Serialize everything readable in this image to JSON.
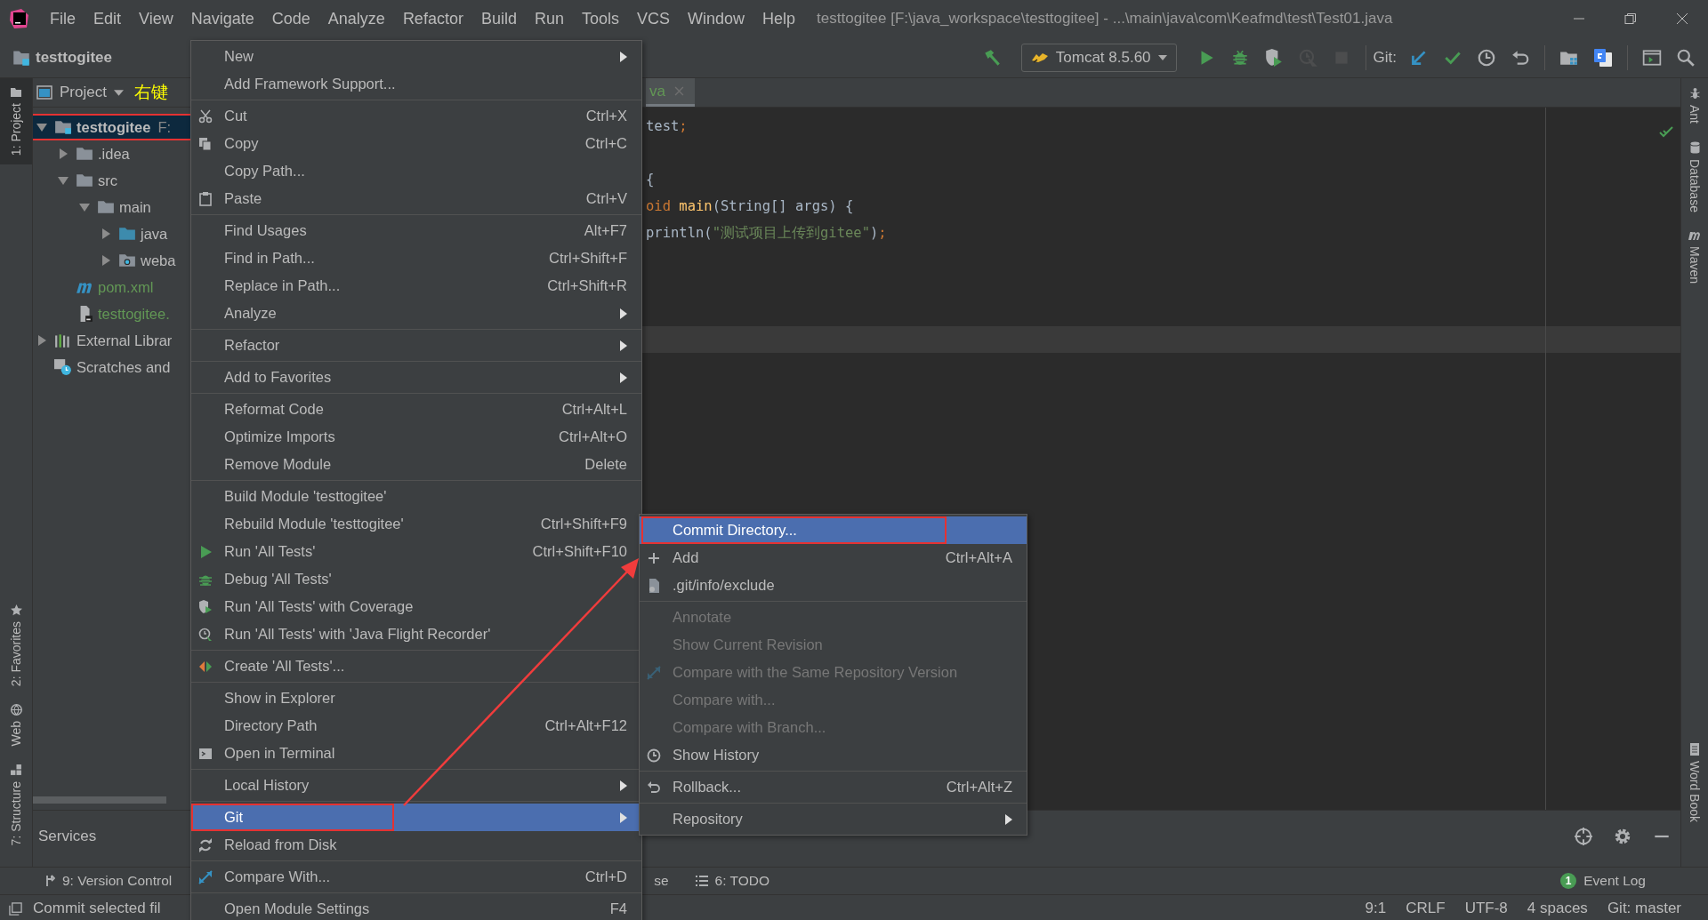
{
  "title_bar": {
    "menus": [
      "File",
      "Edit",
      "View",
      "Navigate",
      "Code",
      "Analyze",
      "Refactor",
      "Build",
      "Run",
      "Tools",
      "VCS",
      "Window",
      "Help"
    ],
    "title": "testtogitee [F:\\java_workspace\\testtogitee] - ...\\main\\java\\com\\Keafmd\\test\\Test01.java"
  },
  "nav_bar": {
    "breadcrumb": "testtogitee",
    "run_config": "Tomcat 8.5.60",
    "git_label": "Git:",
    "run_buttons": [
      {
        "kind": "build",
        "disabled": false
      },
      {
        "kind": "run",
        "disabled": false
      },
      {
        "kind": "debug",
        "disabled": false
      },
      {
        "kind": "coverage",
        "disabled": false
      },
      {
        "kind": "profile",
        "disabled": true
      },
      {
        "kind": "stop",
        "disabled": true
      }
    ],
    "vcs_buttons": [
      {
        "kind": "update",
        "disabled": false
      },
      {
        "kind": "commit",
        "disabled": false
      },
      {
        "kind": "history",
        "disabled": false
      },
      {
        "kind": "revert",
        "disabled": false
      }
    ],
    "tool_buttons": [
      {
        "kind": "structure",
        "disabled": false
      },
      {
        "kind": "translate",
        "disabled": false
      },
      {
        "kind": "terminal",
        "disabled": false
      },
      {
        "kind": "search",
        "disabled": false
      }
    ]
  },
  "left_strip": {
    "top": [
      {
        "label": "1: Project",
        "kind": "project",
        "selected": true
      }
    ],
    "bottom": [
      {
        "label": "2: Favorites",
        "kind": "favorites",
        "selected": false
      },
      {
        "label": "Web",
        "kind": "web",
        "selected": false
      },
      {
        "label": "7: Structure",
        "kind": "structure",
        "selected": false
      }
    ]
  },
  "project_panel": {
    "title": "Project",
    "annotation": "右键",
    "tree": [
      {
        "label": "testtogitee",
        "path": "F:",
        "kind": "module",
        "expanded": true,
        "selected": true,
        "added": false,
        "annotated": true,
        "children": [
          {
            "label": ".idea",
            "kind": "folder",
            "expanded": false,
            "selected": false,
            "added": false,
            "annotated": false
          },
          {
            "label": "src",
            "kind": "folder",
            "expanded": true,
            "selected": false,
            "added": false,
            "annotated": false,
            "children": [
              {
                "label": "main",
                "kind": "folder",
                "expanded": true,
                "selected": false,
                "added": false,
                "annotated": false,
                "children": [
                  {
                    "label": "java",
                    "kind": "source-root",
                    "expanded": false,
                    "selected": false,
                    "added": false,
                    "annotated": false
                  },
                  {
                    "label": "weba",
                    "kind": "web-root",
                    "expanded": false,
                    "selected": false,
                    "added": false,
                    "annotated": false
                  }
                ]
              }
            ]
          },
          {
            "label": "pom.xml",
            "kind": "maven-file",
            "selected": false,
            "added": true,
            "annotated": false
          },
          {
            "label": "testtogitee.",
            "kind": "module-file",
            "selected": false,
            "added": true,
            "annotated": false
          }
        ]
      },
      {
        "label": "External Librar",
        "kind": "libraries",
        "expanded": false,
        "selected": false,
        "added": false,
        "annotated": false
      },
      {
        "label": "Scratches and",
        "kind": "scratches",
        "selected": false,
        "added": false,
        "annotated": false
      }
    ]
  },
  "editor": {
    "tab": "va",
    "lines": [
      {
        "current": false,
        "tokens": [
          {
            "text": "test",
            "kind": "plain"
          },
          {
            "text": ";",
            "kind": "punct"
          }
        ]
      },
      {
        "current": false
      },
      {
        "current": false,
        "tokens": [
          {
            "text": "{",
            "kind": "plain"
          }
        ]
      },
      {
        "current": false,
        "tokens": [
          {
            "text": "oid ",
            "kind": "keyword"
          },
          {
            "text": "main",
            "kind": "method"
          },
          {
            "text": "(String[] args) {",
            "kind": "plain"
          }
        ]
      },
      {
        "current": false,
        "tokens": [
          {
            "text": "println(",
            "kind": "plain"
          },
          {
            "text": "\"测试项目上传到gitee\"",
            "kind": "string"
          },
          {
            "text": ")",
            "kind": "plain"
          },
          {
            "text": ";",
            "kind": "punct"
          }
        ]
      },
      {
        "current": false
      },
      {
        "current": false
      },
      {
        "current": false
      },
      {
        "current": true
      }
    ]
  },
  "right_strip": {
    "top": [
      {
        "label": "Ant",
        "kind": "ant"
      },
      {
        "label": "Database",
        "kind": "database"
      },
      {
        "label": "Maven",
        "kind": "maven"
      }
    ],
    "bottom": [
      {
        "label": "Word Book",
        "kind": "book"
      }
    ]
  },
  "services": {
    "title": "Services"
  },
  "tool_tabs": [
    {
      "label": "9: Version Control",
      "kind": "vcs"
    },
    {
      "label": "se",
      "kind": "plain"
    },
    {
      "label": "6: TODO",
      "kind": "todo"
    }
  ],
  "event_log": {
    "label": "Event Log",
    "count": "1"
  },
  "status_bar": {
    "message": "Commit selected fil",
    "items": [
      "9:1",
      "CRLF",
      "UTF-8",
      "4 spaces",
      "Git: master"
    ]
  },
  "context_menu": {
    "groups": [
      [
        {
          "label": "New",
          "kind": "plain",
          "submenu": true,
          "selected": false,
          "disabled": false,
          "annotated": false
        },
        {
          "label": "Add Framework Support...",
          "kind": "plain",
          "submenu": false,
          "selected": false,
          "disabled": false,
          "annotated": false
        }
      ],
      [
        {
          "label": "Cut",
          "shortcut": "Ctrl+X",
          "kind": "cut",
          "submenu": false,
          "selected": false,
          "disabled": false,
          "annotated": false
        },
        {
          "label": "Copy",
          "shortcut": "Ctrl+C",
          "kind": "copy",
          "submenu": false,
          "selected": false,
          "disabled": false,
          "annotated": false
        },
        {
          "label": "Copy Path...",
          "kind": "plain",
          "submenu": false,
          "selected": false,
          "disabled": false,
          "annotated": false
        },
        {
          "label": "Paste",
          "shortcut": "Ctrl+V",
          "kind": "paste",
          "submenu": false,
          "selected": false,
          "disabled": false,
          "annotated": false
        }
      ],
      [
        {
          "label": "Find Usages",
          "shortcut": "Alt+F7",
          "kind": "plain",
          "submenu": false,
          "selected": false,
          "disabled": false,
          "annotated": false
        },
        {
          "label": "Find in Path...",
          "shortcut": "Ctrl+Shift+F",
          "kind": "plain",
          "submenu": false,
          "selected": false,
          "disabled": false,
          "annotated": false
        },
        {
          "label": "Replace in Path...",
          "shortcut": "Ctrl+Shift+R",
          "kind": "plain",
          "submenu": false,
          "selected": false,
          "disabled": false,
          "annotated": false
        },
        {
          "label": "Analyze",
          "kind": "plain",
          "submenu": true,
          "selected": false,
          "disabled": false,
          "annotated": false
        }
      ],
      [
        {
          "label": "Refactor",
          "kind": "plain",
          "submenu": true,
          "selected": false,
          "disabled": false,
          "annotated": false
        }
      ],
      [
        {
          "label": "Add to Favorites",
          "kind": "plain",
          "submenu": true,
          "selected": false,
          "disabled": false,
          "annotated": false
        }
      ],
      [
        {
          "label": "Reformat Code",
          "shortcut": "Ctrl+Alt+L",
          "kind": "plain",
          "submenu": false,
          "selected": false,
          "disabled": false,
          "annotated": false
        },
        {
          "label": "Optimize Imports",
          "shortcut": "Ctrl+Alt+O",
          "kind": "plain",
          "submenu": false,
          "selected": false,
          "disabled": false,
          "annotated": false
        },
        {
          "label": "Remove Module",
          "shortcut": "Delete",
          "kind": "plain",
          "submenu": false,
          "selected": false,
          "disabled": false,
          "annotated": false
        }
      ],
      [
        {
          "label": "Build Module 'testtogitee'",
          "kind": "plain",
          "submenu": false,
          "selected": false,
          "disabled": false,
          "annotated": false
        },
        {
          "label": "Rebuild Module 'testtogitee'",
          "shortcut": "Ctrl+Shift+F9",
          "kind": "plain",
          "submenu": false,
          "selected": false,
          "disabled": false,
          "annotated": false
        },
        {
          "label": "Run 'All Tests'",
          "shortcut": "Ctrl+Shift+F10",
          "kind": "run",
          "submenu": false,
          "selected": false,
          "disabled": false,
          "annotated": false
        },
        {
          "label": "Debug 'All Tests'",
          "kind": "debug",
          "submenu": false,
          "selected": false,
          "disabled": false,
          "annotated": false
        },
        {
          "label": "Run 'All Tests' with Coverage",
          "kind": "coverage",
          "submenu": false,
          "selected": false,
          "disabled": false,
          "annotated": false
        },
        {
          "label": "Run 'All Tests' with 'Java Flight Recorder'",
          "kind": "profile",
          "submenu": false,
          "selected": false,
          "disabled": false,
          "annotated": false
        }
      ],
      [
        {
          "label": "Create 'All Tests'...",
          "kind": "create",
          "submenu": false,
          "selected": false,
          "disabled": false,
          "annotated": false
        }
      ],
      [
        {
          "label": "Show in Explorer",
          "kind": "plain",
          "submenu": false,
          "selected": false,
          "disabled": false,
          "annotated": false
        },
        {
          "label": "Directory Path",
          "shortcut": "Ctrl+Alt+F12",
          "kind": "plain",
          "submenu": false,
          "selected": false,
          "disabled": false,
          "annotated": false
        },
        {
          "label": "Open in Terminal",
          "kind": "terminal",
          "submenu": false,
          "selected": false,
          "disabled": false,
          "annotated": false
        }
      ],
      [
        {
          "label": "Local History",
          "kind": "plain",
          "submenu": true,
          "selected": false,
          "disabled": false,
          "annotated": false
        }
      ],
      [
        {
          "label": "Git",
          "kind": "plain",
          "submenu": true,
          "selected": true,
          "disabled": false,
          "annotated": true
        },
        {
          "label": "Reload from Disk",
          "kind": "reload",
          "submenu": false,
          "selected": false,
          "disabled": false,
          "annotated": false
        }
      ],
      [
        {
          "label": "Compare With...",
          "shortcut": "Ctrl+D",
          "kind": "compare",
          "submenu": false,
          "selected": false,
          "disabled": false,
          "annotated": false
        }
      ],
      [
        {
          "label": "Open Module Settings",
          "shortcut": "F4",
          "kind": "plain",
          "submenu": false,
          "selected": false,
          "disabled": false,
          "annotated": false
        }
      ]
    ]
  },
  "git_submenu": {
    "groups": [
      [
        {
          "label": "Commit Directory...",
          "kind": "plain",
          "submenu": false,
          "selected": true,
          "disabled": false,
          "annotated": true
        },
        {
          "label": "Add",
          "shortcut": "Ctrl+Alt+A",
          "kind": "add",
          "submenu": false,
          "selected": false,
          "disabled": false,
          "annotated": false
        },
        {
          "label": ".git/info/exclude",
          "kind": "ignore-file",
          "submenu": false,
          "selected": false,
          "disabled": false,
          "annotated": false
        }
      ],
      [
        {
          "label": "Annotate",
          "kind": "plain",
          "submenu": false,
          "selected": false,
          "disabled": true,
          "annotated": false
        },
        {
          "label": "Show Current Revision",
          "kind": "plain",
          "submenu": false,
          "selected": false,
          "disabled": true,
          "annotated": false
        },
        {
          "label": "Compare with the Same Repository Version",
          "kind": "compare",
          "submenu": false,
          "selected": false,
          "disabled": true,
          "annotated": false
        },
        {
          "label": "Compare with...",
          "kind": "plain",
          "submenu": false,
          "selected": false,
          "disabled": true,
          "annotated": false
        },
        {
          "label": "Compare with Branch...",
          "kind": "plain",
          "submenu": false,
          "selected": false,
          "disabled": true,
          "annotated": false
        },
        {
          "label": "Show History",
          "kind": "history",
          "submenu": false,
          "selected": false,
          "disabled": false,
          "annotated": false
        }
      ],
      [
        {
          "label": "Rollback...",
          "shortcut": "Ctrl+Alt+Z",
          "kind": "rollback",
          "submenu": false,
          "selected": false,
          "disabled": false,
          "annotated": false
        }
      ],
      [
        {
          "label": "Repository",
          "kind": "plain",
          "submenu": true,
          "selected": false,
          "disabled": false,
          "annotated": false
        }
      ]
    ]
  }
}
